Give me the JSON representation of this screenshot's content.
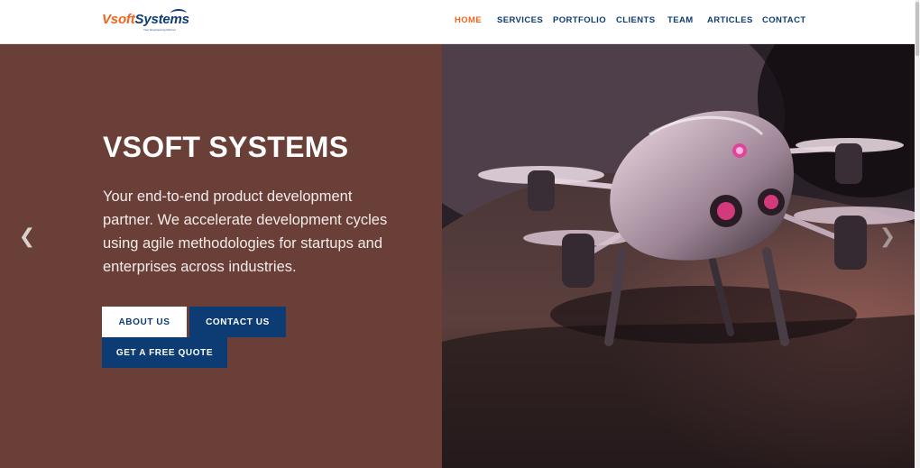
{
  "logo": {
    "part1": "Vsoft",
    "part2": "Systems",
    "tagline": "Your Engineering Partner"
  },
  "nav": {
    "items": [
      {
        "label": "HOME",
        "active": true
      },
      {
        "label": "SERVICES",
        "active": false
      },
      {
        "label": "PORTFOLIO",
        "active": false
      },
      {
        "label": "CLIENTS",
        "active": false
      },
      {
        "label": "TEAM",
        "active": false
      },
      {
        "label": "ARTICLES",
        "active": false
      },
      {
        "label": "CONTACT",
        "active": false
      }
    ]
  },
  "hero": {
    "title": "VSOFT SYSTEMS",
    "description": "Your end-to-end product development partner. We accelerate development cycles using agile methodologies for startups and enterprises across industries.",
    "buttons": {
      "about": "ABOUT US",
      "contact": "CONTACT US",
      "quote": "GET A FREE QUOTE"
    },
    "prev_icon": "chevron-left-icon",
    "next_icon": "chevron-right-icon",
    "image": "drone-photo"
  },
  "colors": {
    "accent": "#f0641e",
    "brand": "#0d3c74",
    "hero_bg": "#6a3f38"
  }
}
